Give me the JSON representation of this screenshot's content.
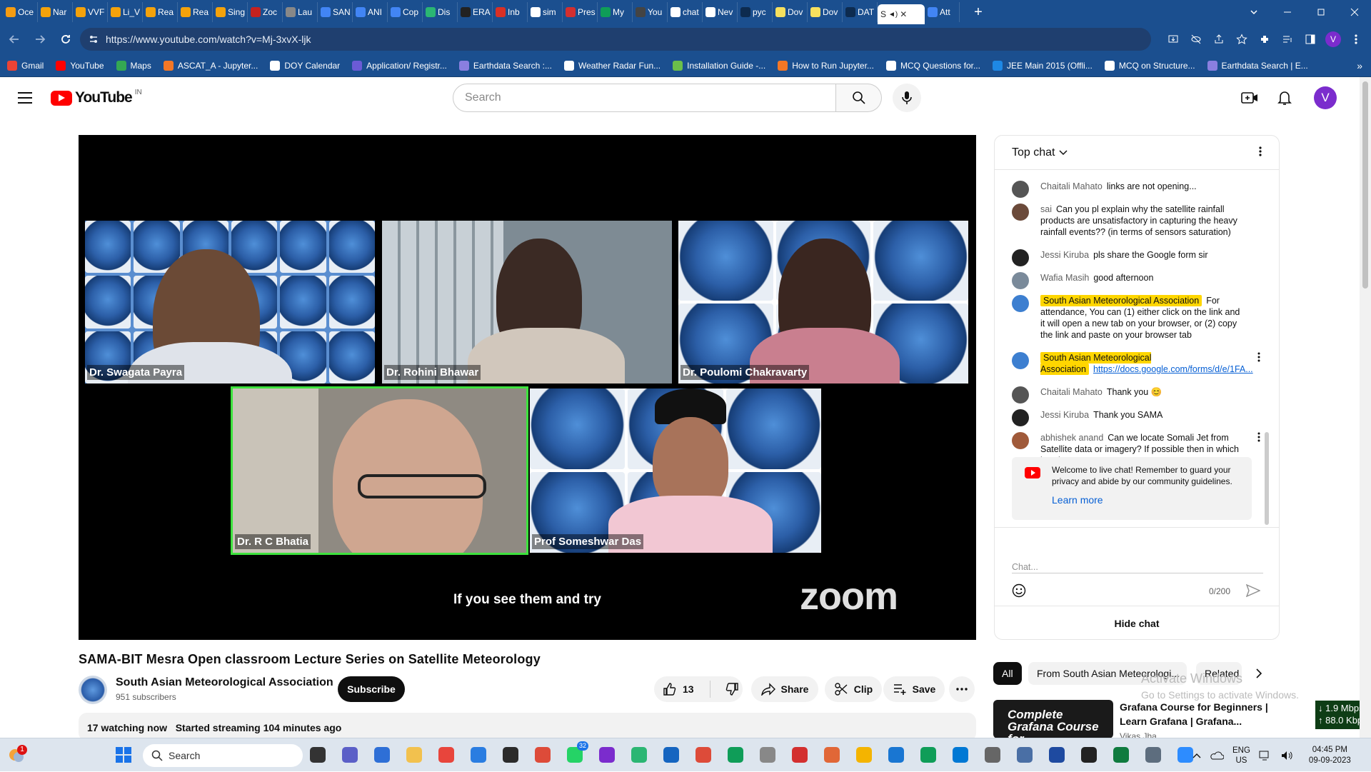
{
  "browser": {
    "tabs": [
      {
        "label": "Oce",
        "color": "#f59c12"
      },
      {
        "label": "Nar",
        "color": "#f4a20b"
      },
      {
        "label": "VVF",
        "color": "#f4a20b"
      },
      {
        "label": "Li_V",
        "color": "#f4a20b"
      },
      {
        "label": "Rea",
        "color": "#f4a20b"
      },
      {
        "label": "Rea",
        "color": "#f4a20b"
      },
      {
        "label": "Sing",
        "color": "#f4a20b"
      },
      {
        "label": "Zoc",
        "color": "#c5221f"
      },
      {
        "label": "Lau",
        "color": "#888888"
      },
      {
        "label": "SAN",
        "color": "#4285f4"
      },
      {
        "label": "ANI",
        "color": "#4285f4"
      },
      {
        "label": "Cop",
        "color": "#4285f4"
      },
      {
        "label": "Dis",
        "color": "#2bb673"
      },
      {
        "label": "ERA",
        "color": "#222222"
      },
      {
        "label": "Inb",
        "color": "#d93025"
      },
      {
        "label": "sim",
        "color": "#ffffff"
      },
      {
        "label": "Pres",
        "color": "#d32f2f"
      },
      {
        "label": "My",
        "color": "#0f9d58"
      },
      {
        "label": "You",
        "color": "#444444"
      },
      {
        "label": "chat",
        "color": "#ffffff"
      },
      {
        "label": "Nev",
        "color": "#ffffff"
      },
      {
        "label": "pyc",
        "color": "#0d2b4f"
      },
      {
        "label": "Dov",
        "color": "#f6e05e"
      },
      {
        "label": "Dov",
        "color": "#f6e05e"
      },
      {
        "label": "DAT",
        "color": "#0d2b4f"
      }
    ],
    "active_tab": {
      "label": "S"
    },
    "last_tab": {
      "label": "Att"
    },
    "url": "https://www.youtube.com/watch?v=Mj-3xvX-ljk",
    "profile_initial": "V",
    "bookmarks": [
      {
        "label": "Gmail",
        "color": "#ea4335"
      },
      {
        "label": "YouTube",
        "color": "#ff0000"
      },
      {
        "label": "Maps",
        "color": "#34a853"
      },
      {
        "label": "ASCAT_A - Jupyter...",
        "color": "#f37726"
      },
      {
        "label": "DOY Calendar",
        "color": "#ffffff"
      },
      {
        "label": "Application/ Registr...",
        "color": "#6b5bd6"
      },
      {
        "label": "Earthdata Search :...",
        "color": "#8a7fe0"
      },
      {
        "label": "Weather Radar Fun...",
        "color": "#ffffff"
      },
      {
        "label": "Installation Guide -...",
        "color": "#6bbf4a"
      },
      {
        "label": "How to Run Jupyter...",
        "color": "#f37726"
      },
      {
        "label": "MCQ Questions for...",
        "color": "#ffffff"
      },
      {
        "label": "JEE Main 2015 (Offli...",
        "color": "#1e88e5"
      },
      {
        "label": "MCQ on Structure...",
        "color": "#ffffff"
      },
      {
        "label": "Earthdata Search | E...",
        "color": "#8a7fe0"
      }
    ]
  },
  "yt": {
    "logo_text": "YouTube",
    "country": "IN",
    "search_placeholder": "Search",
    "avatar_initial": "V"
  },
  "video": {
    "participants": [
      {
        "name": "Dr. Swagata Payra"
      },
      {
        "name": "Dr. Rohini Bhawar"
      },
      {
        "name": "Dr. Poulomi Chakravarty"
      },
      {
        "name": "Dr. R C Bhatia"
      },
      {
        "name": "Prof Someshwar Das"
      }
    ],
    "subtitle": "If you see them and try",
    "watermark": "zoom",
    "title": "SAMA-BIT Mesra Open classroom Lecture Series on Satellite Meteorology",
    "channel": "South Asian Meteorological Association",
    "subscribers": "951 subscribers",
    "subscribe_label": "Subscribe",
    "likes": "13",
    "share_label": "Share",
    "clip_label": "Clip",
    "save_label": "Save",
    "watching": "17 watching now",
    "started": "Started streaming 104 minutes ago"
  },
  "chat": {
    "header": "Top chat",
    "messages": [
      {
        "author": "Chaitali Mahato",
        "text": "links are not opening...",
        "color": "#555555"
      },
      {
        "author": "sai",
        "text": "Can you pl explain why the satellite rainfall products are unsatisfactory in capturing the heavy rainfall events?? (in terms of sensors saturation)",
        "color": "#6b4a3a"
      },
      {
        "author": "Jessi Kiruba",
        "text": "pls share the Google form sir",
        "color": "#222222"
      },
      {
        "author": "Wafia Masih",
        "text": "good afternoon",
        "color": "#7a8a9a"
      },
      {
        "author": "South Asian Meteorological Association",
        "text": "For attendance, You can (1) either click on the link and it will open a new tab on your browser, or (2) copy the link and paste on your browser tab",
        "color": "#3d7fd0",
        "highlight": true
      },
      {
        "author": "South Asian Meteorological Association",
        "text": "https://docs.google.com/forms/d/e/1FA...",
        "color": "#3d7fd0",
        "highlight": true,
        "link": true
      },
      {
        "author": "Chaitali Mahato",
        "text": "Thank you 😊",
        "color": "#555555"
      },
      {
        "author": "Jessi Kiruba",
        "text": "Thank you SAMA",
        "color": "#222222"
      },
      {
        "author": "abhishek anand",
        "text": "Can we locate Somali Jet from Satellite data or imagery? If possible then in which band IR, WV or SWIR.",
        "color": "#a05a3a"
      }
    ],
    "welcome_text": "Welcome to live chat! Remember to guard your privacy and abide by our community guidelines.",
    "learn_more": "Learn more",
    "input_placeholder": "Chat...",
    "char_count": "0/200",
    "hide_chat": "Hide chat"
  },
  "chips": {
    "all": "All",
    "from": "From South Asian Meteorologi...",
    "related": "Related"
  },
  "activate_windows": {
    "title": "Activate Windows",
    "subtitle": "Go to Settings to activate Windows."
  },
  "related_video": {
    "thumb_text": "Complete Grafana Course for",
    "title": "Grafana Course for Beginners | Learn Grafana | Grafana...",
    "channel": "Vikas Jha"
  },
  "netspeed": {
    "down": "↓ 1.9 Mbps",
    "up": "↑ 88.0 Kbps"
  },
  "taskbar": {
    "search_label": "Search",
    "weather_badge": "1",
    "apps": [
      {
        "name": "file-manager",
        "color": "#333333"
      },
      {
        "name": "teams",
        "color": "#5b5fc7"
      },
      {
        "name": "power-automate",
        "color": "#2e6fd6"
      },
      {
        "name": "file-explorer",
        "color": "#f2c14e"
      },
      {
        "name": "anydesk",
        "color": "#e8453c"
      },
      {
        "name": "photos",
        "color": "#2a7de1"
      },
      {
        "name": "terminal",
        "color": "#2b2b2b"
      },
      {
        "name": "chrome",
        "color": "#dd4b39"
      },
      {
        "name": "whatsapp",
        "color": "#25d366",
        "badge": "32"
      },
      {
        "name": "chrome-profile",
        "color": "#7b2ccd"
      },
      {
        "name": "circle-app",
        "color": "#2bb673"
      },
      {
        "name": "vscode-like",
        "color": "#1565c0"
      },
      {
        "name": "chrome-2",
        "color": "#dd4b39"
      },
      {
        "name": "chrome-3",
        "color": "#0f9d58"
      },
      {
        "name": "notepad",
        "color": "#888888"
      },
      {
        "name": "acrobat",
        "color": "#d32f2f"
      },
      {
        "name": "matlab",
        "color": "#e16737"
      },
      {
        "name": "chrome-4",
        "color": "#f4b400"
      },
      {
        "name": "tablet-app",
        "color": "#1976d2"
      },
      {
        "name": "chrome-5",
        "color": "#0f9d58"
      },
      {
        "name": "remote",
        "color": "#0078d4"
      },
      {
        "name": "chart-app",
        "color": "#666666"
      },
      {
        "name": "monitor",
        "color": "#4a6fa5"
      },
      {
        "name": "notes-app",
        "color": "#1e4aa0"
      },
      {
        "name": "cmd",
        "color": "#222222"
      },
      {
        "name": "excel-like",
        "color": "#0f7b3f"
      },
      {
        "name": "clock-app",
        "color": "#5d6d7e"
      },
      {
        "name": "zoom",
        "color": "#2d8cff"
      }
    ],
    "lang_top": "ENG",
    "lang_bottom": "US",
    "time": "04:45 PM",
    "date": "09-09-2023"
  }
}
